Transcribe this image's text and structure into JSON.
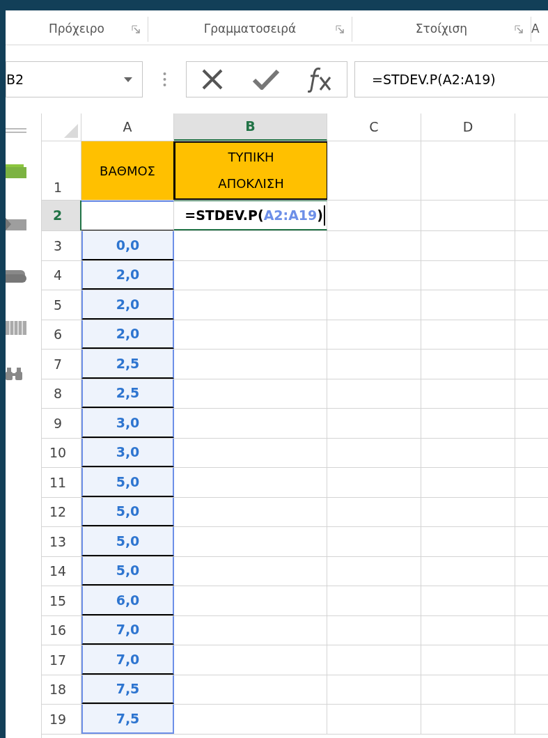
{
  "ribbon_groups": [
    {
      "label": "Πρόχειρο",
      "launcher": true
    },
    {
      "label": "Γραμματοσειρά",
      "launcher": true
    },
    {
      "label": "Στοίχιση",
      "launcher": true
    },
    {
      "label": "Α",
      "launcher": false
    }
  ],
  "name_box": {
    "value": "B2"
  },
  "formula_bar": {
    "buttons": [
      {
        "kind": "cancel"
      },
      {
        "kind": "enter"
      },
      {
        "kind": "function"
      }
    ],
    "value": "=STDEV.P(A2:A19)"
  },
  "columns": [
    {
      "label": "A",
      "selected": false
    },
    {
      "label": "B",
      "selected": true
    },
    {
      "label": "C",
      "selected": false
    },
    {
      "label": "D",
      "selected": false
    }
  ],
  "rows": [
    {
      "row": "1",
      "selected": false,
      "kind": "header",
      "a": "ΒΑΘΜΟΣ",
      "b": "ΤΥΠΙΚΗ ΑΠΟΚΛΙΣΗ"
    },
    {
      "row": "2",
      "selected": true,
      "kind": "edit",
      "b_edit": {
        "prefix": "=STDEV.P(",
        "reference": "A2:A19",
        "suffix": ")"
      }
    },
    {
      "row": "3",
      "selected": false,
      "kind": "value",
      "a": "0,0"
    },
    {
      "row": "4",
      "selected": false,
      "kind": "value",
      "a": "2,0"
    },
    {
      "row": "5",
      "selected": false,
      "kind": "value",
      "a": "2,0"
    },
    {
      "row": "6",
      "selected": false,
      "kind": "value",
      "a": "2,0"
    },
    {
      "row": "7",
      "selected": false,
      "kind": "value",
      "a": "2,5"
    },
    {
      "row": "8",
      "selected": false,
      "kind": "value",
      "a": "2,5"
    },
    {
      "row": "9",
      "selected": false,
      "kind": "value",
      "a": "3,0"
    },
    {
      "row": "10",
      "selected": false,
      "kind": "value",
      "a": "3,0"
    },
    {
      "row": "11",
      "selected": false,
      "kind": "value",
      "a": "5,0"
    },
    {
      "row": "12",
      "selected": false,
      "kind": "value",
      "a": "5,0"
    },
    {
      "row": "13",
      "selected": false,
      "kind": "value",
      "a": "5,0"
    },
    {
      "row": "14",
      "selected": false,
      "kind": "value",
      "a": "5,0"
    },
    {
      "row": "15",
      "selected": false,
      "kind": "value",
      "a": "6,0"
    },
    {
      "row": "16",
      "selected": false,
      "kind": "value",
      "a": "7,0"
    },
    {
      "row": "17",
      "selected": false,
      "kind": "value",
      "a": "7,0"
    },
    {
      "row": "18",
      "selected": false,
      "kind": "value",
      "a": "7,5"
    },
    {
      "row": "19",
      "selected": false,
      "kind": "value",
      "a": "7,5"
    }
  ]
}
